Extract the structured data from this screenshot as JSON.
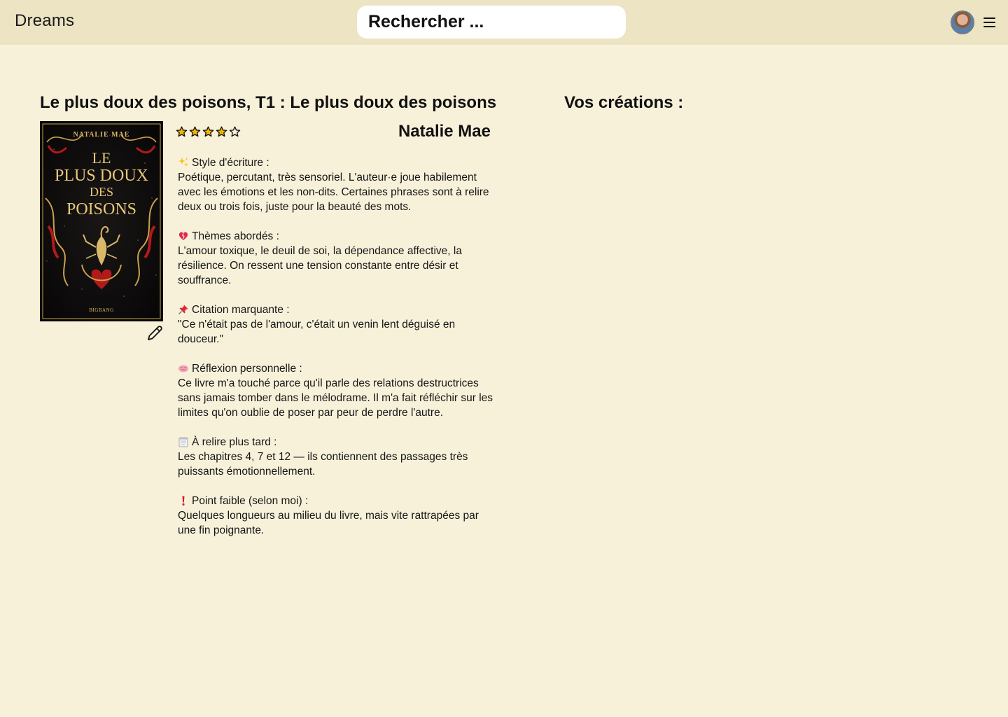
{
  "header": {
    "brand": "Dreams",
    "search_placeholder": "Rechercher ...",
    "avatar_icon": "avatar",
    "menu_icon": "hamburger-menu-icon"
  },
  "book": {
    "title": "Le plus doux des poisons, T1 : Le plus doux des poisons",
    "author": "Natalie Mae",
    "rating": 4,
    "rating_max": 5,
    "cover": {
      "author": "NATALIE MAE",
      "title_line1": "LE",
      "title_line2": "PLUS DOUX",
      "title_line3": "DES",
      "title_line4": "POISONS",
      "publisher": "BIGBANG"
    },
    "edit_icon": "pencil-icon"
  },
  "review": {
    "sections": [
      {
        "icon": "sparkles-icon",
        "heading": "Style d'écriture :",
        "body": "Poétique, percutant, très sensoriel. L'auteur·e joue habilement avec les émotions et les non-dits. Certaines phrases sont à relire deux ou trois fois, juste pour la beauté des mots."
      },
      {
        "icon": "broken-heart-icon",
        "heading": "Thèmes abordés :",
        "body": "L'amour toxique, le deuil de soi, la dépendance affective, la résilience. On ressent une tension constante entre désir et souffrance."
      },
      {
        "icon": "pushpin-icon",
        "heading": "Citation marquante :",
        "body": "\"Ce n'était pas de l'amour, c'était un venin lent déguisé en douceur.\""
      },
      {
        "icon": "brain-icon",
        "heading": "Réflexion personnelle :",
        "body": "Ce livre m'a touché parce qu'il parle des relations destructrices sans jamais tomber dans le mélodrame. Il m'a fait réfléchir sur les limites qu'on oublie de poser par peur de perdre l'autre."
      },
      {
        "icon": "notepad-icon",
        "heading": "À relire plus tard :",
        "body": "Les chapitres 4, 7 et 12 — ils contiennent des passages très puissants émotionnellement."
      },
      {
        "icon": "exclamation-icon",
        "heading": "Point faible (selon moi) :",
        "body": "Quelques longueurs au milieu du livre, mais vite rattrapées par une fin poignante."
      }
    ]
  },
  "creations": {
    "title": "Vos créations :"
  },
  "colors": {
    "page_bg": "#f8f1da",
    "header_bg": "#ece4c2",
    "star_fill": "#f2b705"
  }
}
